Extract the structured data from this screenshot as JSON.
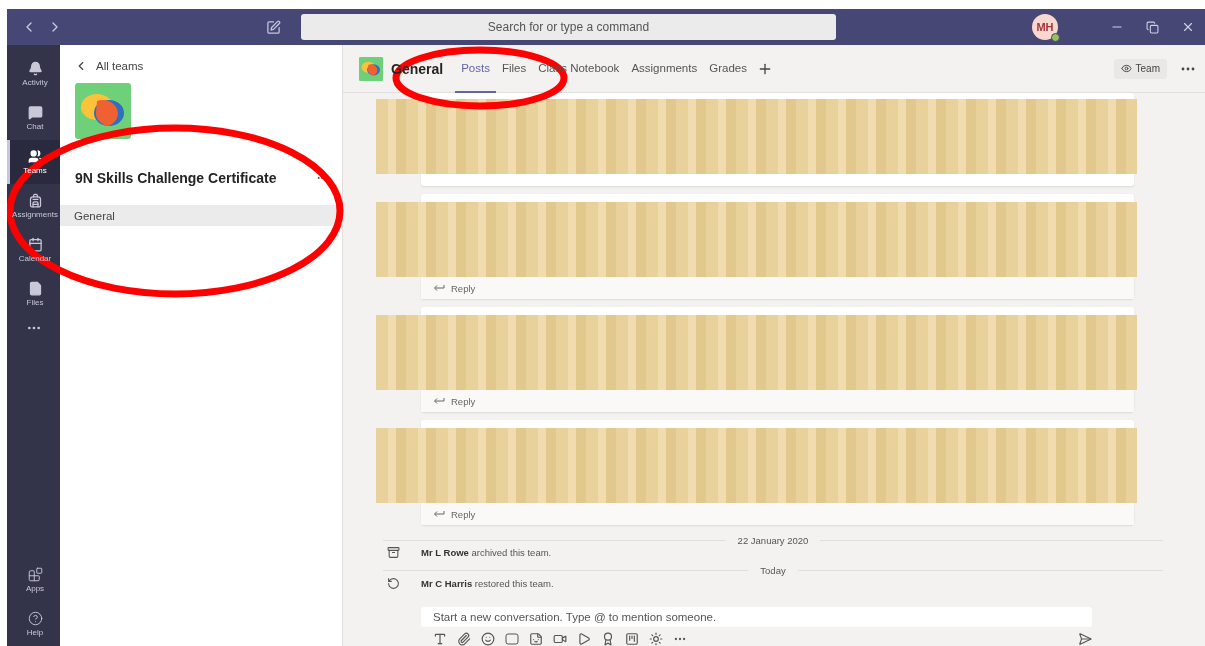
{
  "title_bar": {
    "search": {
      "placeholder": "Search for or type a command"
    },
    "avatar": {
      "initials": "MH"
    }
  },
  "rail": {
    "items": [
      {
        "kind": "activity",
        "label": "Activity",
        "selected": false
      },
      {
        "kind": "chat",
        "label": "Chat",
        "selected": false
      },
      {
        "kind": "teams",
        "label": "Teams",
        "selected": true
      },
      {
        "kind": "assignments",
        "label": "Assignments",
        "selected": false
      },
      {
        "kind": "calendar",
        "label": "Calendar",
        "selected": false
      },
      {
        "kind": "files",
        "label": "Files",
        "selected": false
      }
    ],
    "bottom_items": [
      {
        "kind": "apps",
        "label": "Apps"
      },
      {
        "kind": "help",
        "label": "Help"
      }
    ]
  },
  "team_panel": {
    "back_link": "All teams",
    "team_name": "9N Skills Challenge Certificate",
    "channels": [
      {
        "name": "General",
        "selected": true
      }
    ]
  },
  "channel_header": {
    "title": "General",
    "tabs": [
      {
        "label": "Posts",
        "selected": true
      },
      {
        "label": "Files",
        "selected": false
      },
      {
        "label": "Class Notebook",
        "selected": false
      },
      {
        "label": "Assignments",
        "selected": false
      },
      {
        "label": "Grades",
        "selected": false
      }
    ],
    "team_button": "Team"
  },
  "posts": [
    {
      "kind": "clipped"
    },
    {
      "kind": "full",
      "reply": "Reply"
    },
    {
      "kind": "full",
      "reply": "Reply"
    },
    {
      "kind": "full",
      "reply": "Reply"
    }
  ],
  "timeline": [
    {
      "kind": "divider",
      "text": "22 January 2020"
    },
    {
      "kind": "archive",
      "text": "**Mr L Rowe** archived this team."
    },
    {
      "kind": "divider",
      "text": "Today"
    },
    {
      "kind": "restore",
      "text": "**Mr C Harris** restored this team."
    }
  ],
  "compose": {
    "placeholder": "Start a new conversation. Type @ to mention someone."
  }
}
